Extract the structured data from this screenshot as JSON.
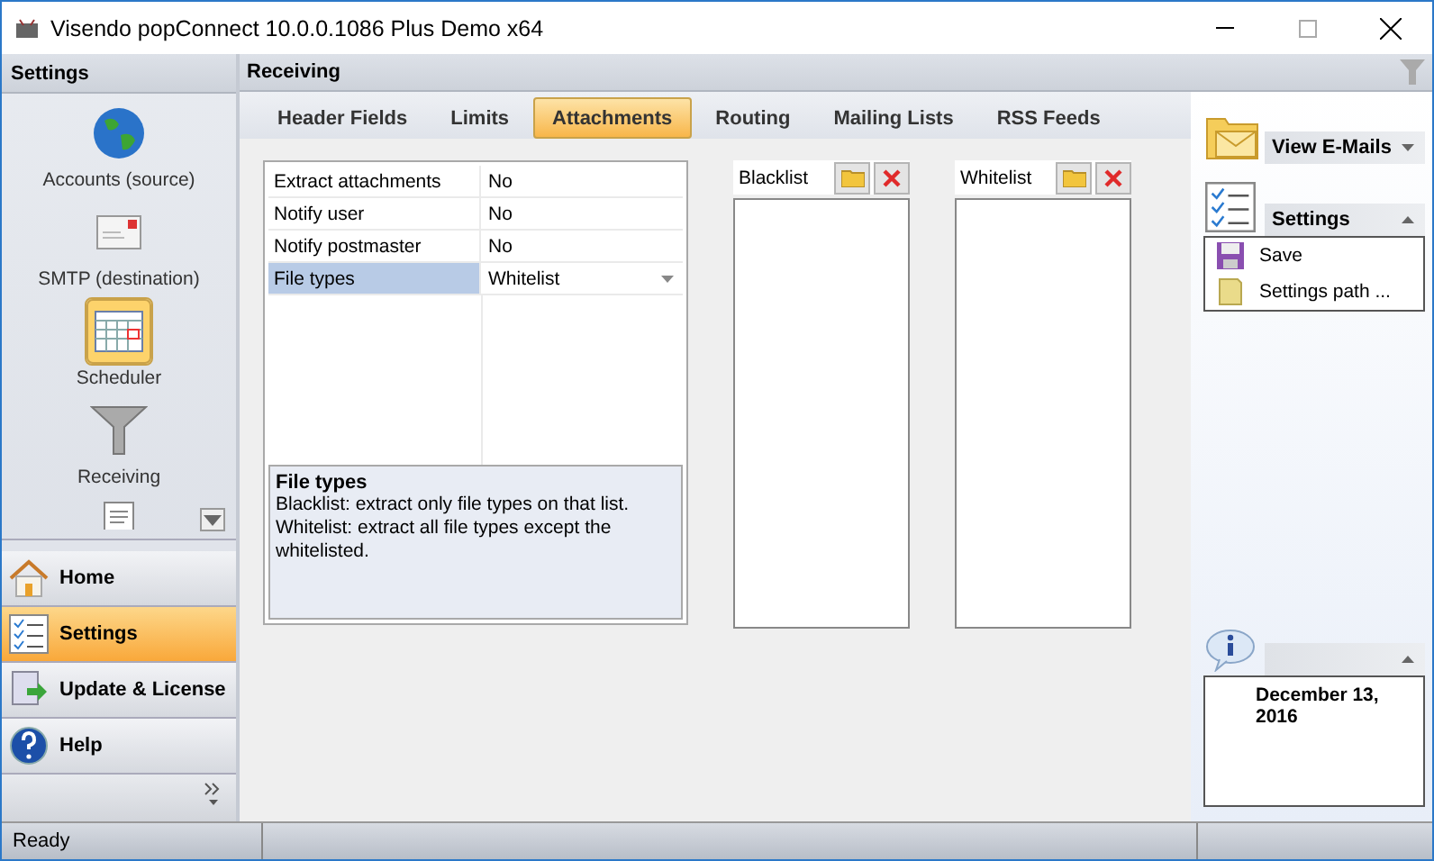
{
  "window": {
    "title": "Visendo popConnect 10.0.0.1086 Plus Demo x64"
  },
  "sidebar": {
    "title": "Settings",
    "items": [
      {
        "label": "Accounts (source)",
        "selected": false
      },
      {
        "label": "SMTP (destination)",
        "selected": false
      },
      {
        "label": "Scheduler",
        "selected": true
      },
      {
        "label": "Receiving",
        "selected": false
      }
    ],
    "nav": [
      {
        "label": "Home",
        "selected": false
      },
      {
        "label": "Settings",
        "selected": true
      },
      {
        "label": "Update & License",
        "selected": false
      },
      {
        "label": "Help",
        "selected": false
      }
    ]
  },
  "main": {
    "title": "Receiving",
    "tabs": [
      {
        "label": "Header Fields",
        "selected": false
      },
      {
        "label": "Limits",
        "selected": false
      },
      {
        "label": "Attachments",
        "selected": true
      },
      {
        "label": "Routing",
        "selected": false
      },
      {
        "label": "Mailing Lists",
        "selected": false
      },
      {
        "label": "RSS Feeds",
        "selected": false
      }
    ],
    "properties": [
      {
        "name": "Extract attachments",
        "value": "No",
        "kind": "text",
        "selected": false
      },
      {
        "name": "Notify user",
        "value": "No",
        "kind": "text",
        "selected": false
      },
      {
        "name": "Notify postmaster",
        "value": "No",
        "kind": "text",
        "selected": false
      },
      {
        "name": "File types",
        "value": "Whitelist",
        "kind": "dropdown",
        "selected": true
      }
    ],
    "description": {
      "title": "File types",
      "text": "Blacklist: extract only file types on that list. Whitelist: extract all file types except the whitelisted."
    },
    "lists": [
      {
        "title": "Blacklist"
      },
      {
        "title": "Whitelist"
      }
    ]
  },
  "right_panel": {
    "view_emails": "View E-Mails",
    "settings": {
      "title": "Settings",
      "expanded": true,
      "items": [
        {
          "label": "Save"
        },
        {
          "label": "Settings path ..."
        }
      ]
    },
    "info": {
      "text": "December 13, 2016"
    }
  },
  "status_bar": {
    "text": "Ready"
  }
}
